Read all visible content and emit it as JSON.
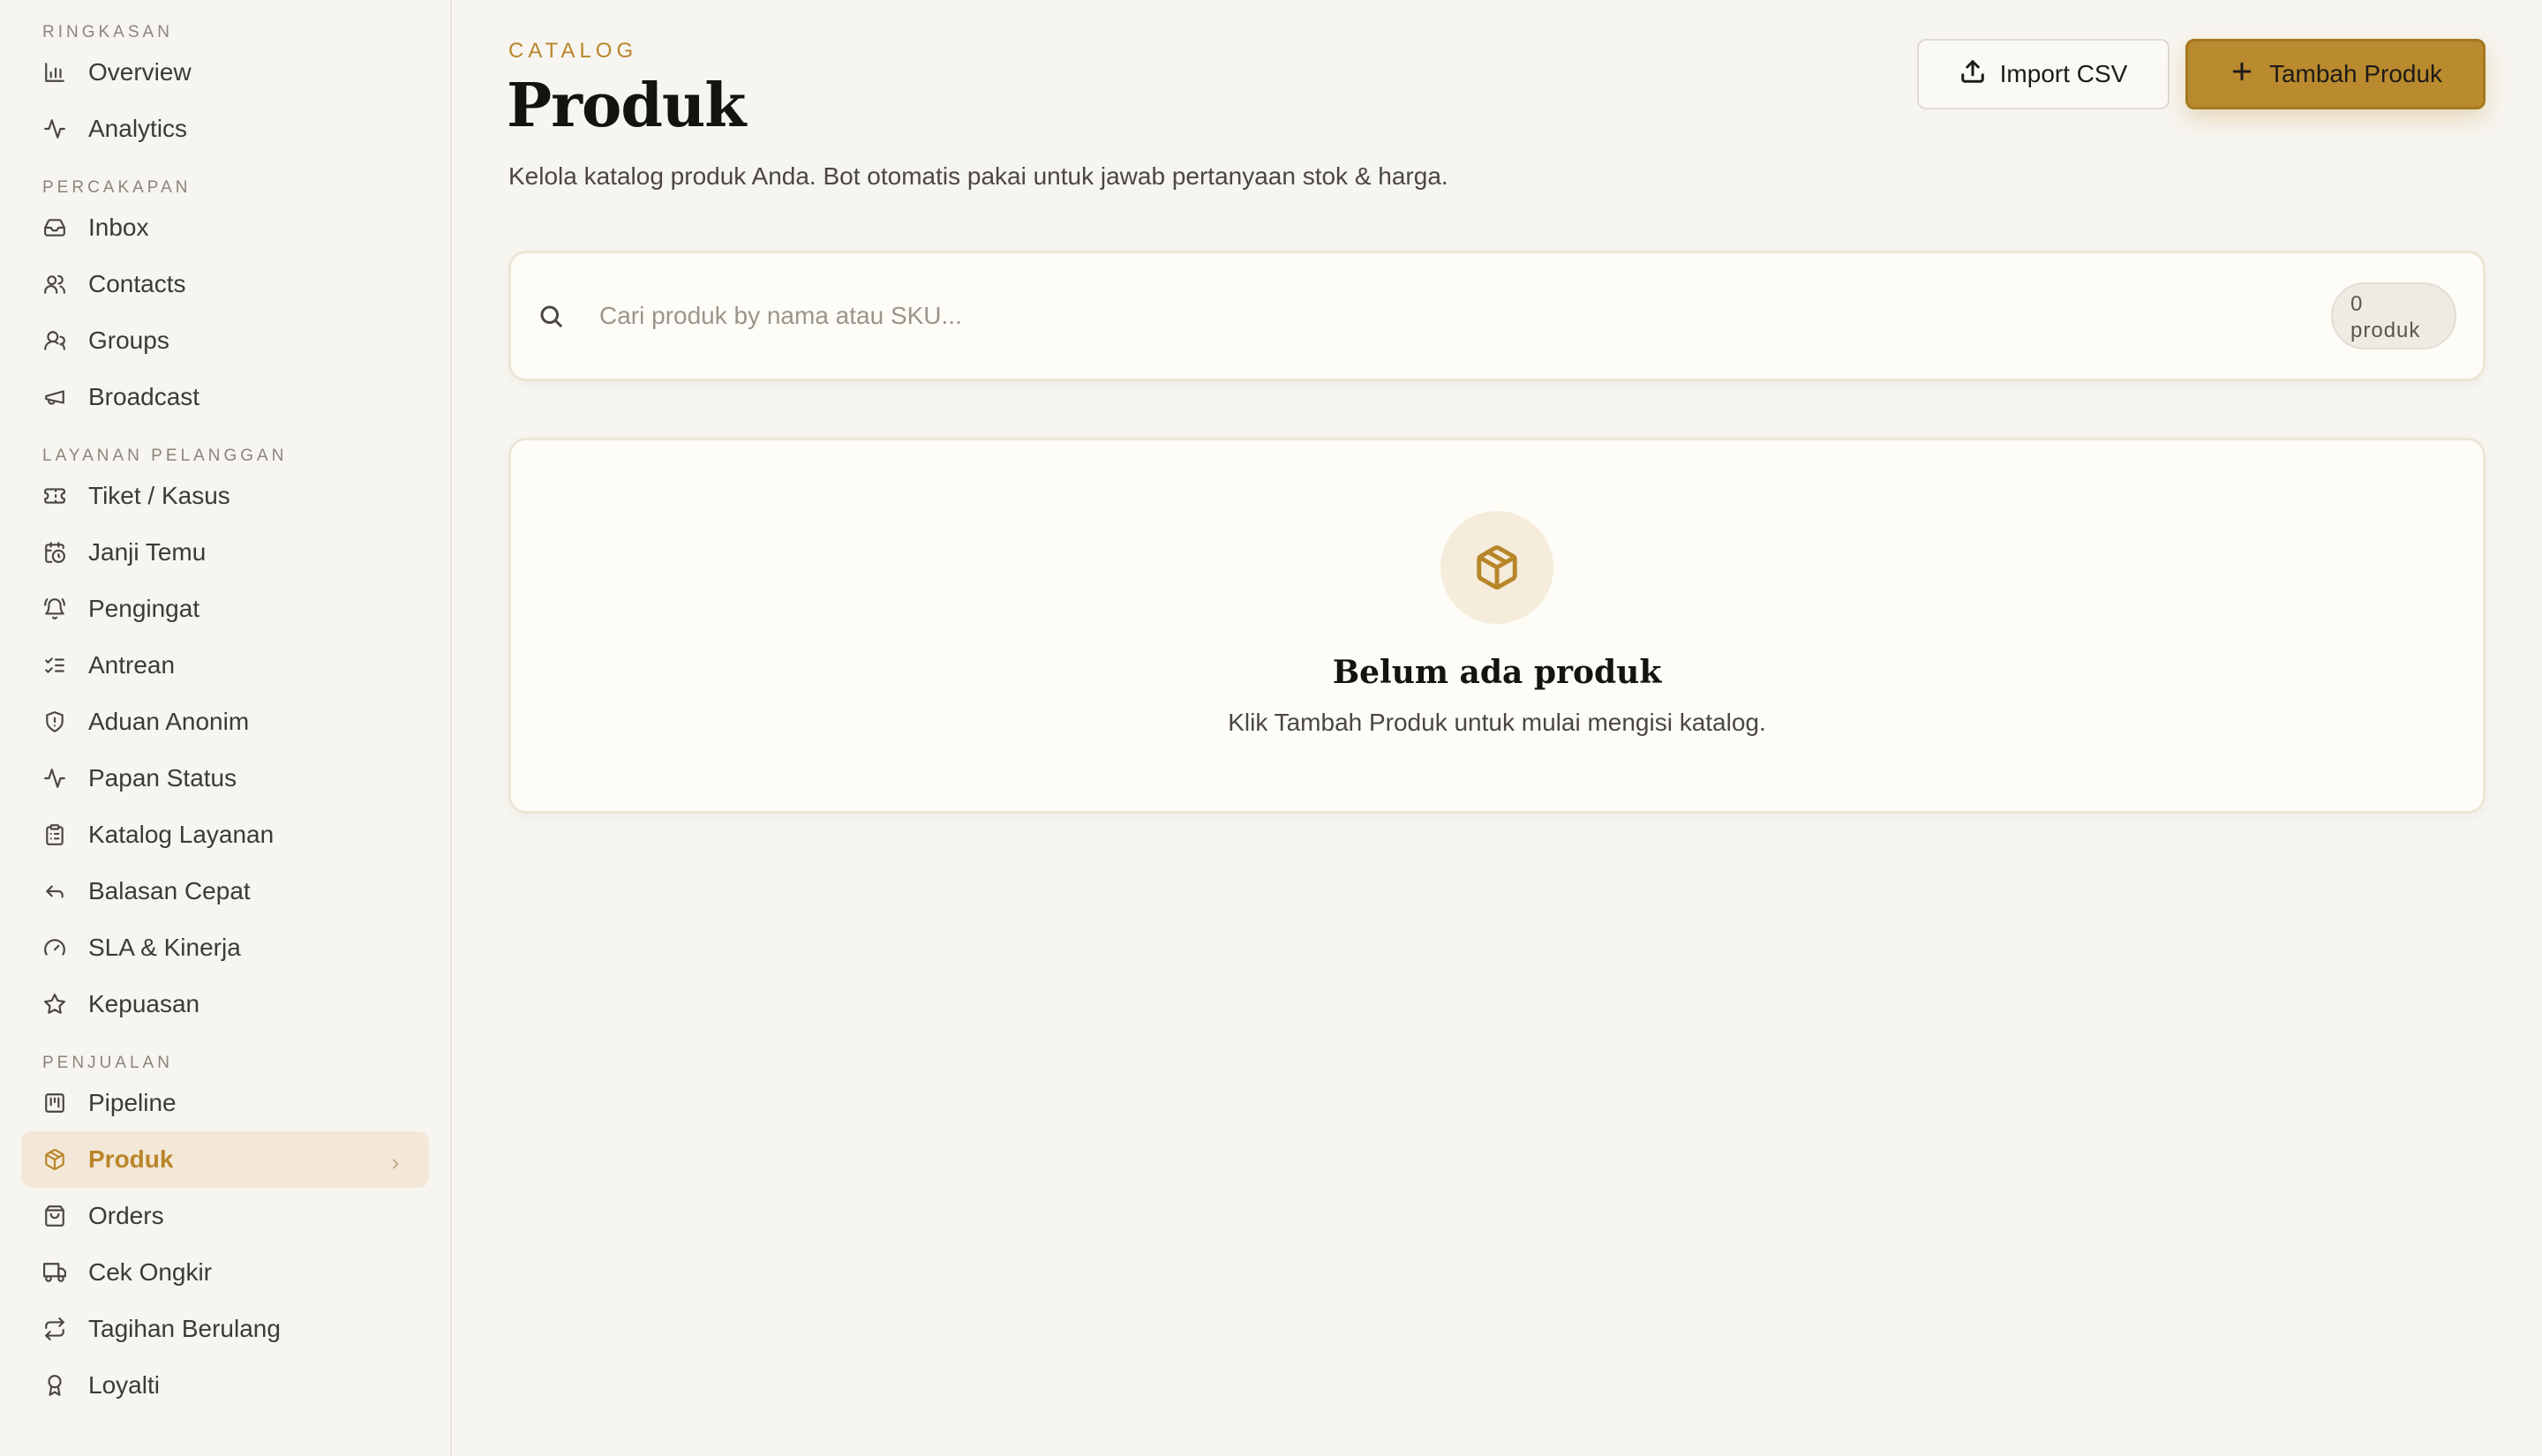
{
  "sidebar": {
    "sections": {
      "ringkasan": "RINGKASAN",
      "percakapan": "PERCAKAPAN",
      "layanan": "LAYANAN PELANGGAN",
      "penjualan": "PENJUALAN"
    },
    "items": {
      "overview": "Overview",
      "analytics": "Analytics",
      "inbox": "Inbox",
      "contacts": "Contacts",
      "groups": "Groups",
      "broadcast": "Broadcast",
      "tiket": "Tiket / Kasus",
      "janji": "Janji Temu",
      "pengingat": "Pengingat",
      "antrean": "Antrean",
      "aduan": "Aduan Anonim",
      "papan": "Papan Status",
      "katalog": "Katalog Layanan",
      "balasan": "Balasan Cepat",
      "sla": "SLA & Kinerja",
      "kepuasan": "Kepuasan",
      "pipeline": "Pipeline",
      "produk": "Produk",
      "orders": "Orders",
      "ongkir": "Cek Ongkir",
      "tagihan": "Tagihan Berulang",
      "loyalti": "Loyalti"
    },
    "active_item": "produk"
  },
  "header": {
    "eyebrow": "CATALOG",
    "title": "Produk",
    "description": "Kelola katalog produk Anda. Bot otomatis pakai untuk jawab pertanyaan stok & harga.",
    "import_label": "Import CSV",
    "add_label": "Tambah Produk"
  },
  "search": {
    "placeholder": "Cari produk by nama atau SKU...",
    "value": "",
    "count_number": "0",
    "count_unit": "produk"
  },
  "empty_state": {
    "title": "Belum ada produk",
    "description": "Klik Tambah Produk untuk mulai mengisi katalog."
  },
  "colors": {
    "accent": "#ba8a2f",
    "active_bg": "#f3e8d8",
    "page_bg": "#f7f5f0",
    "card_bg": "#fefcf6"
  },
  "icons": {
    "overview": "bar-chart-icon",
    "analytics": "activity-icon",
    "inbox": "inbox-icon",
    "contacts": "users-icon",
    "groups": "users-round-icon",
    "broadcast": "megaphone-icon",
    "tiket": "ticket-icon",
    "janji": "calendar-clock-icon",
    "pengingat": "bell-ring-icon",
    "antrean": "list-checks-icon",
    "aduan": "shield-icon",
    "papan": "activity-icon",
    "katalog": "clipboard-list-icon",
    "balasan": "reply-icon",
    "sla": "gauge-icon",
    "kepuasan": "star-icon",
    "pipeline": "kanban-icon",
    "produk": "package-icon",
    "orders": "shopping-bag-icon",
    "ongkir": "truck-icon",
    "tagihan": "repeat-icon",
    "loyalti": "award-icon"
  }
}
